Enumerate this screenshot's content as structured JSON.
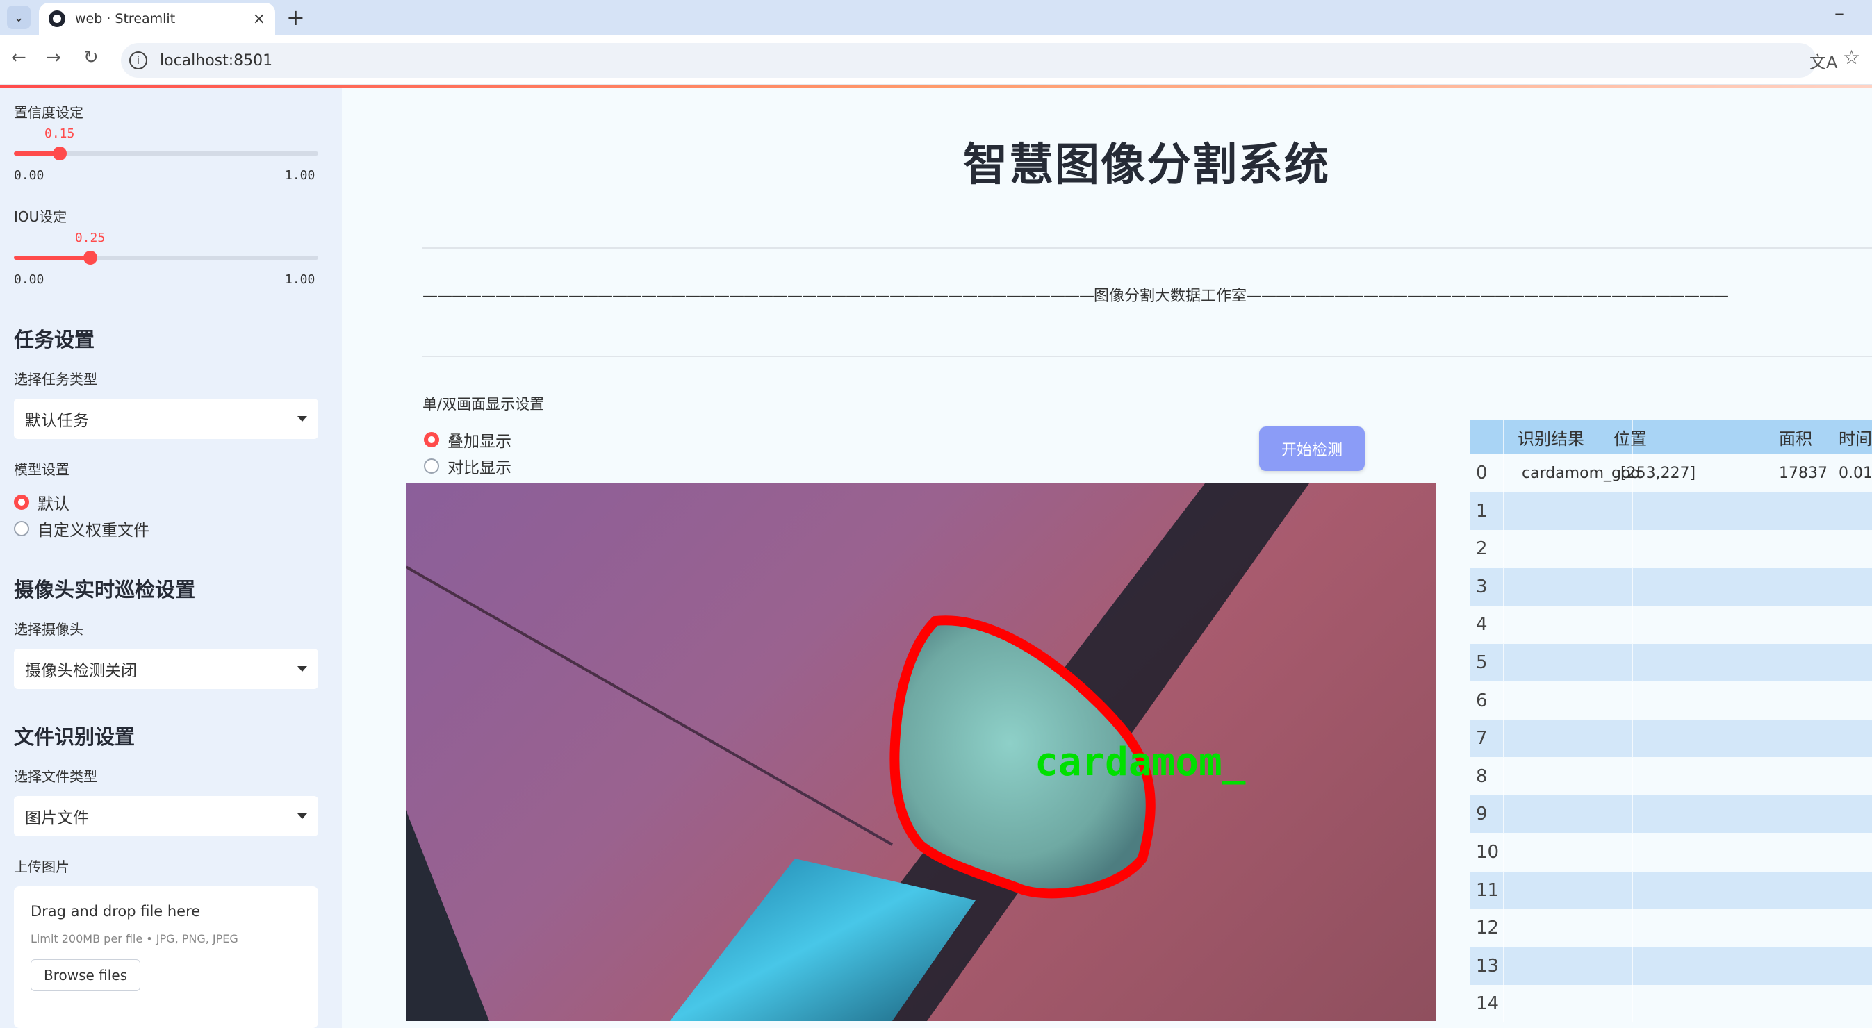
{
  "browser": {
    "tab_title": "web · Streamlit",
    "url": "localhost:8501",
    "new_tab": "+",
    "close": "×",
    "minimize": "–"
  },
  "sidebar": {
    "confidence_label": "置信度设定",
    "confidence_value": "0.15",
    "confidence_min": "0.00",
    "confidence_max": "1.00",
    "confidence_fraction": 0.15,
    "iou_label": "IOU设定",
    "iou_value": "0.25",
    "iou_min": "0.00",
    "iou_max": "1.00",
    "iou_fraction": 0.25,
    "task_heading": "任务设置",
    "task_type_label": "选择任务类型",
    "task_type_value": "默认任务",
    "model_label": "模型设置",
    "model_options": [
      "默认",
      "自定义权重文件"
    ],
    "model_selected": 0,
    "camera_heading": "摄像头实时巡检设置",
    "camera_label": "选择摄像头",
    "camera_value": "摄像头检测关闭",
    "file_heading": "文件识别设置",
    "file_type_label": "选择文件类型",
    "file_type_value": "图片文件",
    "upload_label": "上传图片",
    "upload_title": "Drag and drop file here",
    "upload_limit": "Limit 200MB per file • JPG, PNG, JPEG",
    "browse_label": "Browse files"
  },
  "main": {
    "title": "智慧图像分割系统",
    "studio_text": "图像分割大数据工作室",
    "display_label": "单/双画面显示设置",
    "display_options": [
      "叠加显示",
      "对比显示"
    ],
    "display_selected": 0,
    "detect_button": "开始检测",
    "overlay_label": "cardamom_"
  },
  "table": {
    "headers": [
      "识别结果",
      "位置",
      "面积",
      "时间"
    ],
    "rows": [
      {
        "index": "0",
        "result": "cardamom_goo",
        "position": "[253,227]",
        "area": "17837",
        "time": "0.01"
      },
      {
        "index": "1"
      },
      {
        "index": "2"
      },
      {
        "index": "3"
      },
      {
        "index": "4"
      },
      {
        "index": "5"
      },
      {
        "index": "6"
      },
      {
        "index": "7"
      },
      {
        "index": "8"
      },
      {
        "index": "9"
      },
      {
        "index": "10"
      },
      {
        "index": "11"
      },
      {
        "index": "12"
      },
      {
        "index": "13"
      },
      {
        "index": "14"
      }
    ]
  },
  "colors": {
    "accent": "#ff4b4b",
    "detect_button": "#8b9cf7",
    "table_header": "#a9d4f5",
    "mask_outline": "#ff0000",
    "label_green": "#00e000"
  }
}
